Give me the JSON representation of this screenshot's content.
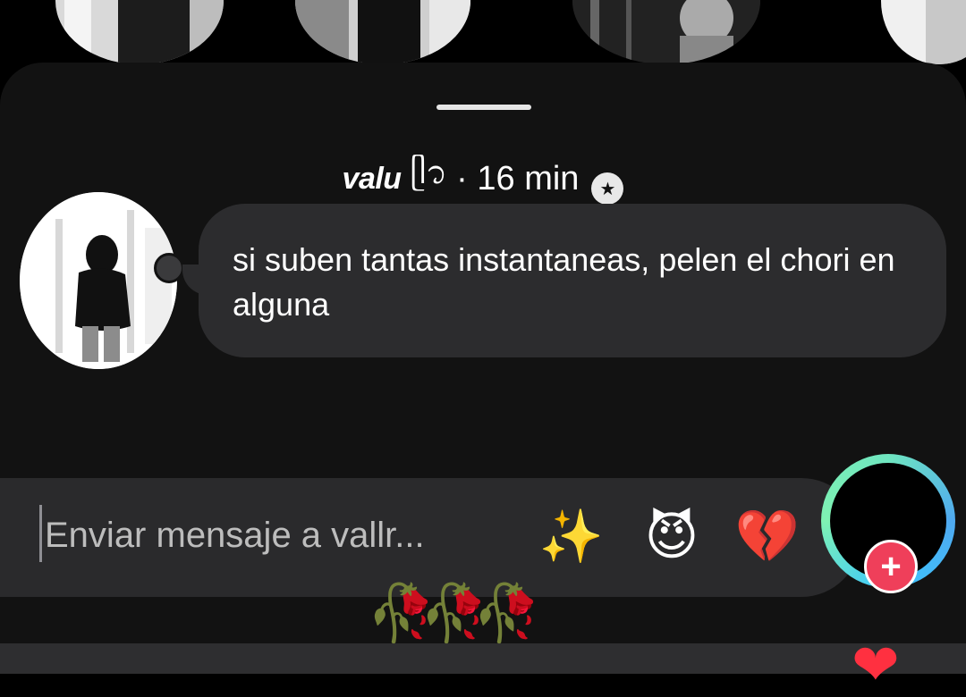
{
  "header": {
    "username": "valu",
    "username_symbol": "ᥫ᭡",
    "meta": "· 16 min",
    "badge_icon": "star-icon"
  },
  "message": {
    "text": "si suben tantas instantaneas, pelen el chori en alguna"
  },
  "composer": {
    "placeholder": "Enviar mensaje a vallr..."
  },
  "reactions": [
    {
      "name": "sparkles",
      "glyph": "✨"
    },
    {
      "name": "smiling-devil",
      "glyph": "😈"
    },
    {
      "name": "broken-heart",
      "glyph": "💔"
    }
  ],
  "decorations": {
    "roses": "🥀🥀🥀"
  },
  "colors": {
    "sheet_bg": "#121212",
    "bubble_bg": "#2c2c2e",
    "composer_bg": "#2a2a2c",
    "add_button": "#ef3f5a",
    "heart": "#ff3040"
  }
}
